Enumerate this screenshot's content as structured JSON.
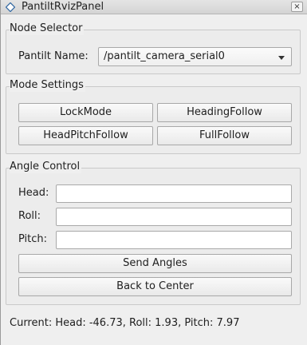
{
  "window": {
    "title": "PantiltRvizPanel",
    "close_label": "×"
  },
  "node_selector": {
    "title": "Node Selector",
    "pantilt_label": "Pantilt Name:",
    "selected_node": "/pantilt_camera_serial0"
  },
  "mode_settings": {
    "title": "Mode Settings",
    "buttons": [
      "LockMode",
      "HeadingFollow",
      "HeadPitchFollow",
      "FullFollow"
    ]
  },
  "angle_control": {
    "title": "Angle Control",
    "head_label": "Head:",
    "roll_label": "Roll:",
    "pitch_label": "Pitch:",
    "head_value": "",
    "roll_value": "",
    "pitch_value": "",
    "send_label": "Send Angles",
    "center_label": "Back to Center"
  },
  "status": {
    "text": "Current: Head: -46.73, Roll: 1.93, Pitch: 7.97"
  }
}
